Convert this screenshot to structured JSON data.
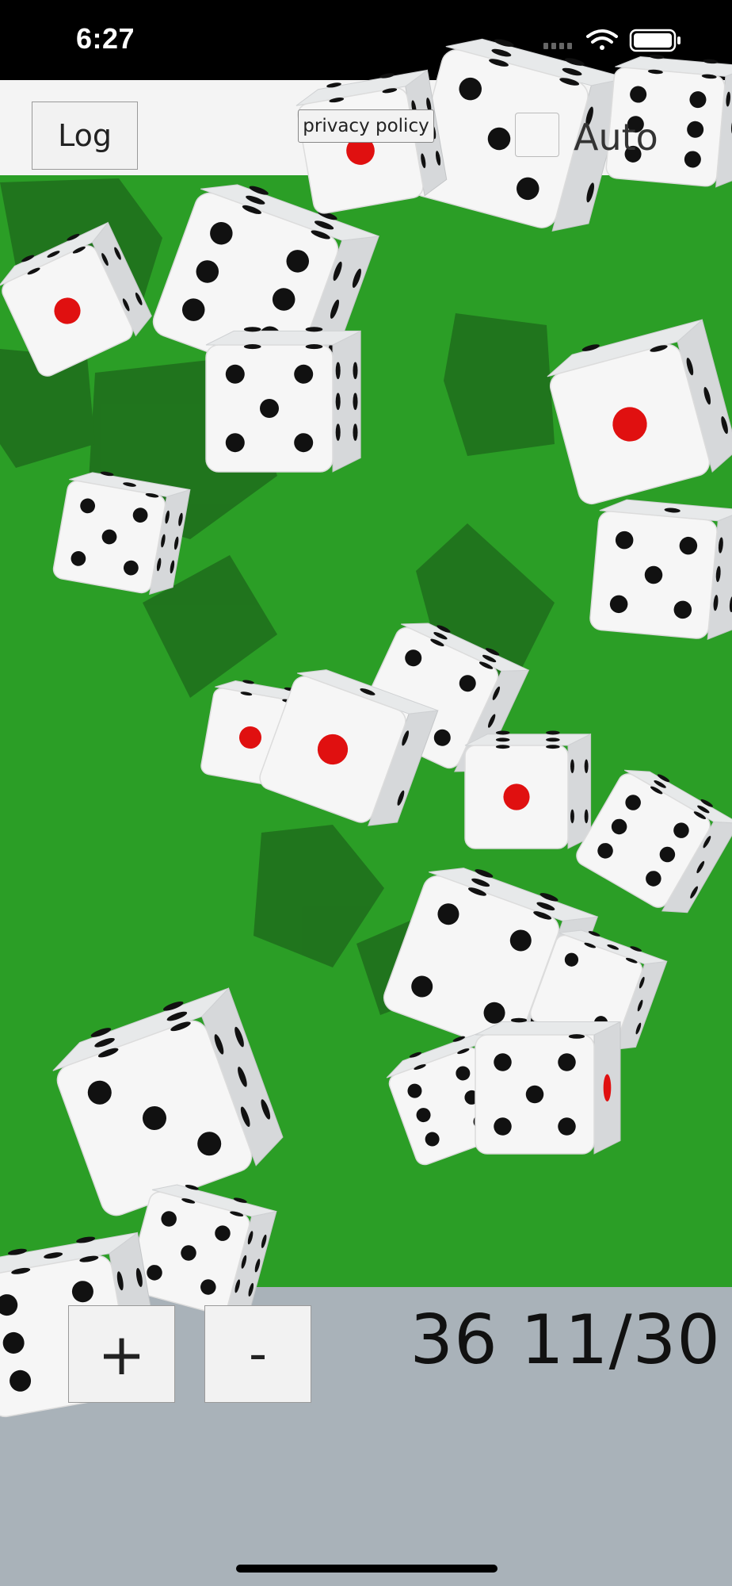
{
  "status_bar": {
    "time": "6:27"
  },
  "toolbar": {
    "log_label": "Log",
    "privacy_label": "privacy policy",
    "auto_label": "Auto",
    "auto_checked": false
  },
  "controls": {
    "plus_label": "+",
    "minus_label": "-",
    "counter_text": "36 11/30"
  },
  "colors": {
    "felt": "#2b9e26",
    "felt_shadow": "#1f6d1c",
    "bottom_panel": "#a9b2b9",
    "die_face": "#f6f6f6",
    "pip_black": "#111111",
    "pip_red": "#e01010"
  }
}
